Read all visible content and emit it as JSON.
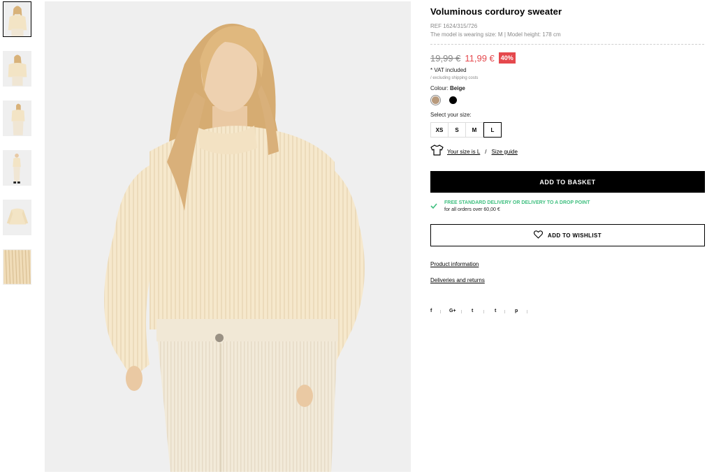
{
  "product": {
    "title": "Voluminous corduroy sweater",
    "ref": "REF 1624/315/726",
    "model_info": "The model is wearing size: M | Model height: 178 cm"
  },
  "price": {
    "old": "19,99 €",
    "new": "11,99 €",
    "discount": "40%",
    "vat": "* VAT included",
    "shipping_note": "/ excluding shipping costs"
  },
  "colour": {
    "label": "Colour:",
    "selected": "Beige",
    "swatches": [
      {
        "name": "Beige",
        "hex": "#b89a7c"
      },
      {
        "name": "Black",
        "hex": "#000000"
      }
    ]
  },
  "sizes": {
    "label": "Select your size:",
    "options": [
      "XS",
      "S",
      "M",
      "L"
    ],
    "selected": "L"
  },
  "size_help": {
    "your_size": "Your size is L",
    "separator": "/",
    "guide": "Size guide"
  },
  "actions": {
    "add_to_basket": "ADD TO BASKET",
    "add_to_wishlist": "ADD TO WISHLIST"
  },
  "delivery": {
    "headline": "FREE STANDARD DELIVERY OR DELIVERY TO A DROP POINT",
    "detail": "for all orders over 60,00 €"
  },
  "links": {
    "product_information": "Product information",
    "deliveries_returns": "Deliveries and returns"
  },
  "social": [
    "f",
    "G+",
    "t",
    "t",
    "p"
  ],
  "colors": {
    "sale": "#e5484d",
    "delivery_green": "#3fbf7f",
    "cream": "#f6e9cf"
  }
}
